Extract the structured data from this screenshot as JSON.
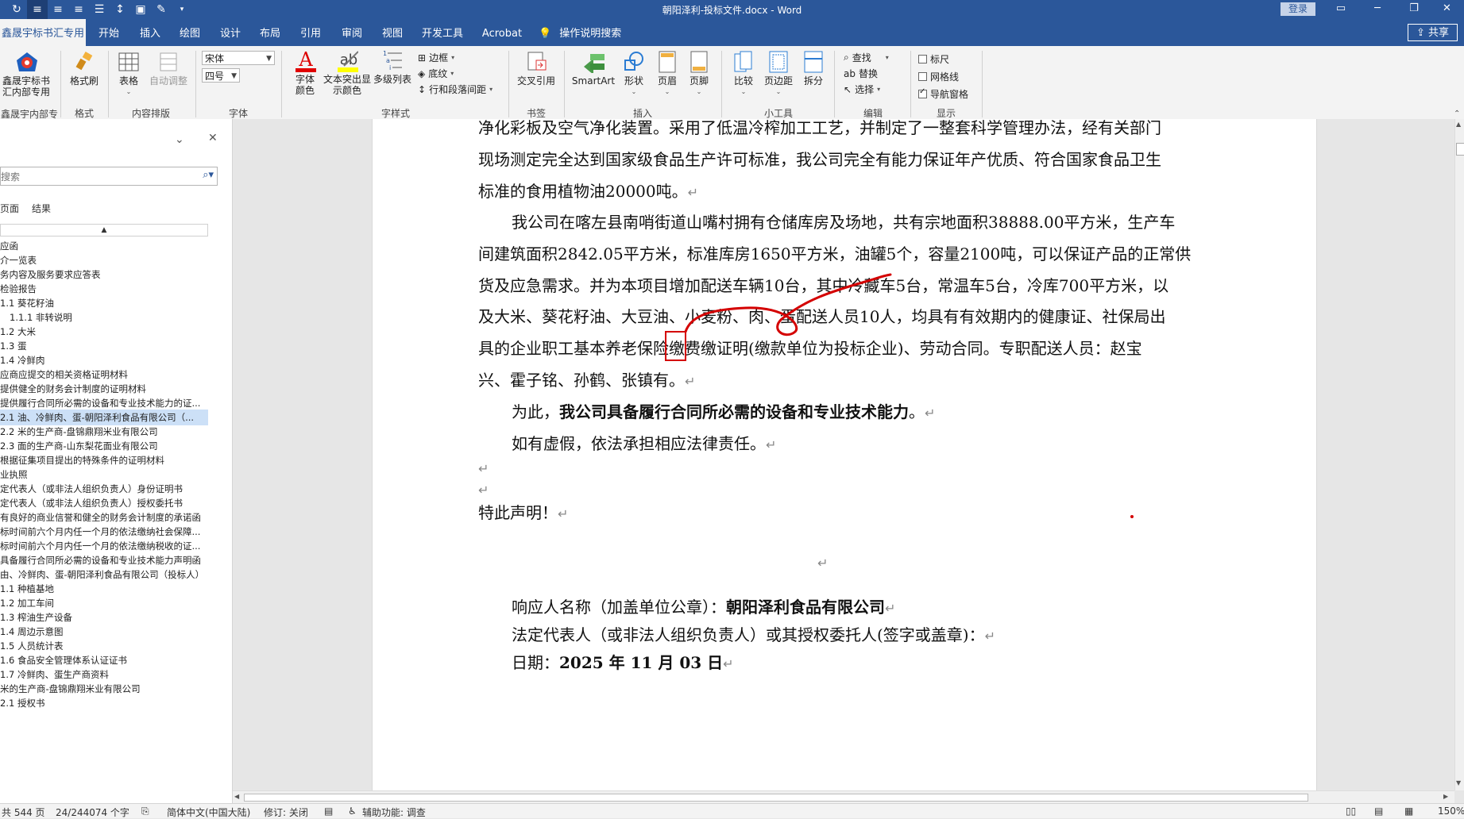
{
  "titlebar": {
    "doc_title": "朝阳泽利-投标文件.docx  -  Word",
    "login": "登录"
  },
  "tabs": [
    "鑫晟宇标书汇专用",
    "开始",
    "插入",
    "绘图",
    "设计",
    "布局",
    "引用",
    "审阅",
    "视图",
    "开发工具",
    "Acrobat",
    "操作说明搜索"
  ],
  "share": "共享",
  "ribbon": {
    "addin": {
      "btn": "鑫晟宇标书汇内部专用",
      "group": "鑫晟宇内部专用"
    },
    "format": {
      "btn": "格式刷",
      "group": "格式"
    },
    "content": {
      "table": "表格",
      "auto": "自动调整",
      "group": "内容排版"
    },
    "font": {
      "name": "宋体",
      "size": "四号",
      "group": "字体"
    },
    "fontstyle": {
      "color": "字体颜色",
      "highlight": "文本突出显示颜色",
      "multilevel": "多级列表",
      "border": "边框",
      "shading": "底纹",
      "spacing": "行和段落间距",
      "group": "字样式"
    },
    "bookmark": {
      "crossref": "交叉引用",
      "group": "书签"
    },
    "insert": {
      "smartart": "SmartArt",
      "shape": "形状",
      "header": "页眉",
      "footer": "页脚",
      "group": "插入"
    },
    "tools": {
      "compare": "比较",
      "margins": "页边距",
      "split": "拆分",
      "group": "小工具"
    },
    "edit": {
      "find": "查找",
      "replace": "替换",
      "select": "选择",
      "group": "编辑"
    },
    "show": {
      "ruler": "标尺",
      "grid": "网格线",
      "nav": "导航窗格",
      "group": "显示"
    }
  },
  "nav": {
    "search_placeholder": "搜索",
    "tab_pages": "页面",
    "tab_results": "结果",
    "items": [
      "应函",
      "介一览表",
      "务内容及服务要求应答表",
      "检验报告",
      "1.1 葵花籽油",
      "1.1.1 非转说明",
      "1.2 大米",
      "1.3 蛋",
      "1.4 冷鲜肉",
      "应商应提交的相关资格证明材料",
      "提供健全的财务会计制度的证明材料",
      "提供履行合同所必需的设备和专业技术能力的证...",
      "2.1 油、冷鲜肉、蛋-朝阳泽利食品有限公司（...",
      "2.2 米的生产商-盘锦鼎翔米业有限公司",
      "2.3 面的生产商-山东梨花面业有限公司",
      "根据征集项目提出的特殊条件的证明材料",
      "业执照",
      "定代表人（或非法人组织负责人）身份证明书",
      "定代表人（或非法人组织负责人）授权委托书",
      "有良好的商业信誉和健全的财务会计制度的承诺函",
      "标时间前六个月内任一个月的依法缴纳社会保障...",
      "标时间前六个月内任一个月的依法缴纳税收的证...",
      "具备履行合同所必需的设备和专业技术能力声明函",
      "由、冷鲜肉、蛋-朝阳泽利食品有限公司（投标人）",
      "1.1 种植基地",
      "1.2 加工车间",
      "1.3 榨油生产设备",
      "1.4 周边示意图",
      "1.5 人员统计表",
      "1.6 食品安全管理体系认证证书",
      "1.7 冷鲜肉、蛋生产商资料",
      "米的生产商-盘锦鼎翔米业有限公司",
      "2.1 授权书"
    ]
  },
  "document": {
    "l1": "净化彩板及空气净化装置。采用了低温冷榨加工工艺，并制定了一整套科学管理办法，经有关部门",
    "l2": "现场测定完全达到国家级食品生产许可标准，我公司完全有能力保证年产优质、符合国家食品卫生",
    "l3": "标准的食用植物油20000吨。",
    "l4": "我公司在喀左县南哨街道山嘴村拥有仓储库房及场地，共有宗地面积38888.00平方米，生产车",
    "l5": "间建筑面积2842.05平方米，标准库房1650平方米，油罐5个，容量2100吨，可以保证产品的正常供",
    "l6": "货及应急需求。并为本项目增加配送车辆10台，其中冷藏车5台，常温车5台，冷库700平方米，以",
    "l7": "及大米、葵花籽油、大豆油、小麦粉、肉、蛋配送人员10人，均具有有效期内的健康证、社保局出",
    "l8": "具的企业职工基本养老保险缴费缴证明(缴款单位为投标企业)、劳动合同。专职配送人员：赵宝",
    "l9": "兴、霍子铭、孙鹤、张镇有。",
    "l10a": "为此，",
    "l10b": "我公司具备履行合同所必需的设备和专业技术能力",
    "l10c": "。",
    "l11": "如有虚假，依法承担相应法律责任。",
    "l12": "特此声明！",
    "sig1a": "响应人名称（加盖单位公章）：",
    "sig1b": "朝阳泽利食品有限公司",
    "sig2": "法定代表人（或非法人组织负责人）或其授权委托人(签字或盖章)：",
    "sig3a": "日期：",
    "sig3b": "2025 年 11 月 03 日",
    "para_mark": "↵"
  },
  "status": {
    "pages": "共 544 页",
    "words": "24/244074 个字",
    "lang": "简体中文(中国大陆)",
    "track": "修订: 关闭",
    "access": "辅助功能: 调查",
    "zoom": "150%"
  },
  "colors": {
    "brand": "#2b579a",
    "ink": "#d40000",
    "nav_selected": "#cce0f7"
  }
}
